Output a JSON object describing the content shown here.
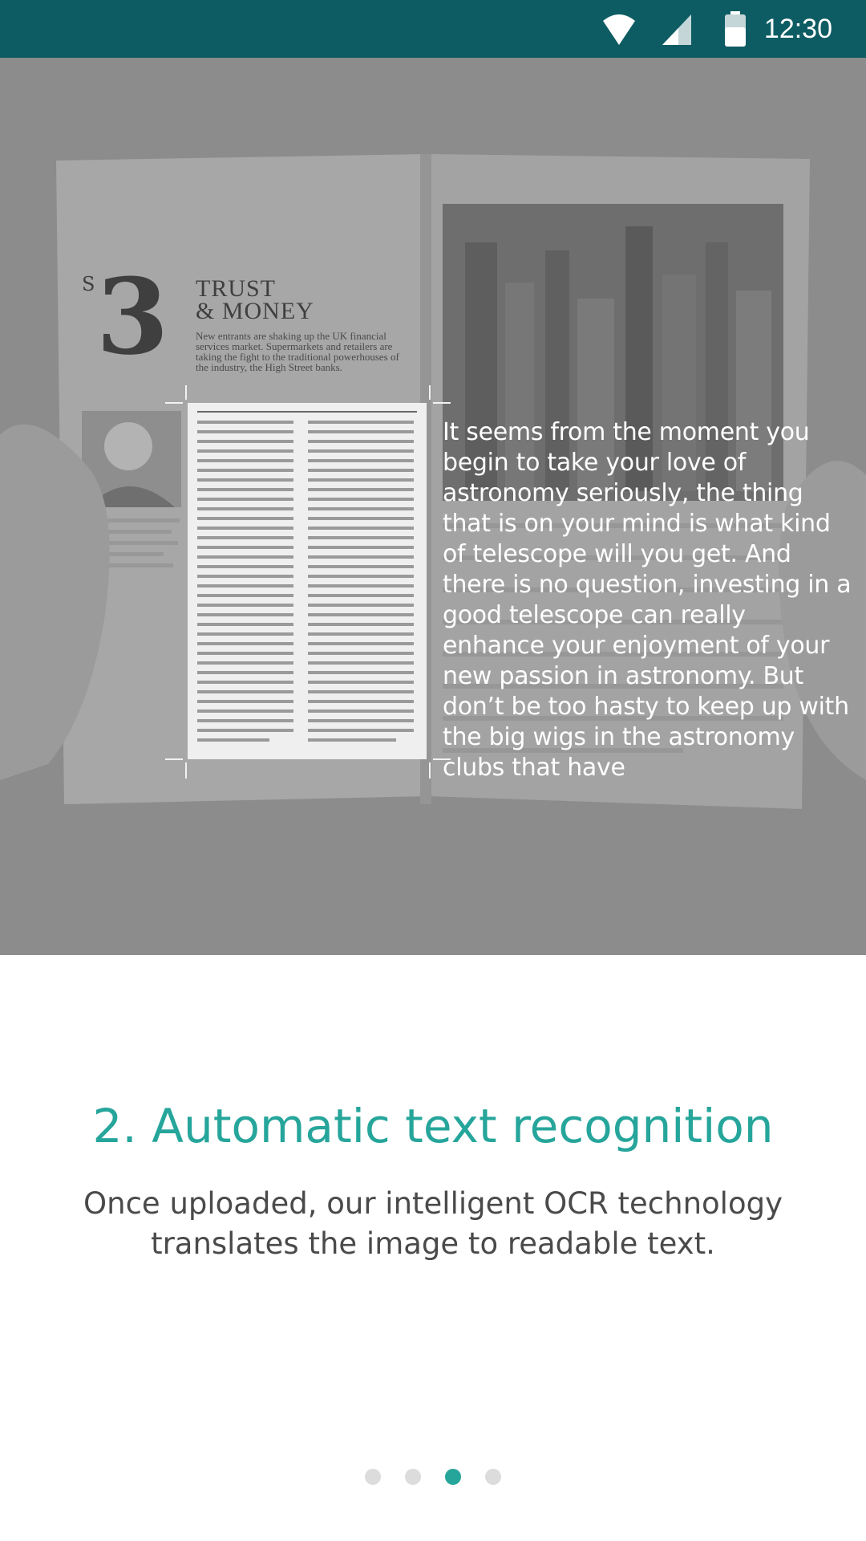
{
  "status_bar": {
    "time": "12:30",
    "icons": [
      "wifi-icon",
      "signal-icon",
      "battery-icon"
    ],
    "background": "#0e5c63"
  },
  "hero": {
    "magazine": {
      "number": "3",
      "superscript": "S",
      "headline_line1": "TRUST",
      "headline_line2": "& MONEY",
      "deck": "New entrants are shaking up the UK financial services market. Supermarkets and retailers are taking the fight to the traditional powerhouses of the industry, the High Street banks."
    },
    "ocr_text": "It seems from the moment you begin to take your love of astronomy seriously, the thing that is on your mind is what kind of telescope will you get. And there is no question, investing in a good telescope can really enhance your enjoyment of your new passion in astronomy. But don’t be too hasty to keep up with the big wigs in the astronomy clubs that have"
  },
  "onboarding": {
    "title": "2. Automatic text recognition",
    "description": "Once uploaded, our intelligent OCR technology translates the image to readable text.",
    "page_indicator": {
      "total": 4,
      "current": 3
    }
  },
  "colors": {
    "accent": "#26a59b",
    "description_text": "#4a4a4a",
    "dot_inactive": "#dcdcdc"
  }
}
